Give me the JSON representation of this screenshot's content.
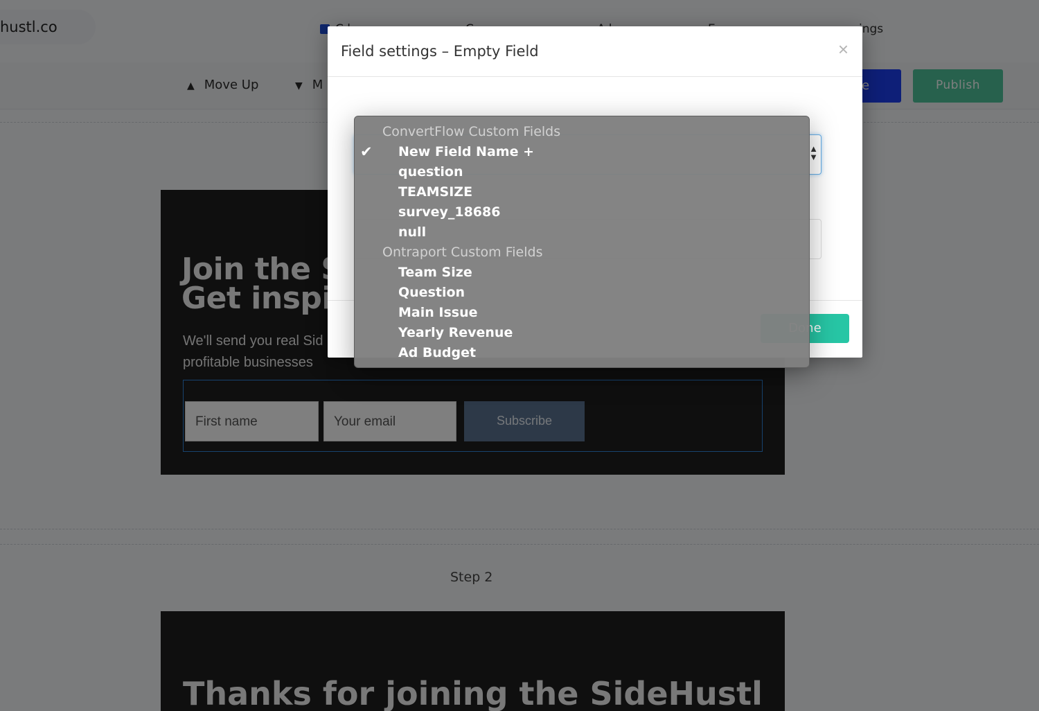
{
  "browser": {
    "url_fragment": "hustl.co"
  },
  "top_tabs": [
    {
      "label": "C.l"
    },
    {
      "label": "C"
    },
    {
      "label": "A.l"
    },
    {
      "label": "E"
    },
    {
      "label": "ings"
    }
  ],
  "toolbar": {
    "move_up": "Move Up",
    "move_down": "M",
    "save": "e",
    "publish": "Publish"
  },
  "step1_card": {
    "title_line1": "Join the S",
    "title_line2": "Get inspi",
    "subtitle": "We'll send you real Sid profitable businesses",
    "first_name_placeholder": "First name",
    "email_placeholder": "Your email",
    "subscribe": "Subscribe"
  },
  "step2": {
    "label": "Step 2",
    "title": "Thanks for joining the SideHustl"
  },
  "modal": {
    "title": "Field settings – Empty Field",
    "close": "×",
    "done": "Done"
  },
  "dropdown": {
    "groups": [
      {
        "label": "ConvertFlow Custom Fields",
        "options": [
          "New Field Name +",
          "question",
          "TEAMSIZE",
          "survey_18686",
          "null"
        ]
      },
      {
        "label": "Ontraport Custom Fields",
        "options": [
          "Team Size",
          "Question",
          "Main Issue",
          "Yearly Revenue",
          "Ad Budget"
        ]
      }
    ],
    "selected": "New Field Name +",
    "check_glyph": "✔"
  }
}
